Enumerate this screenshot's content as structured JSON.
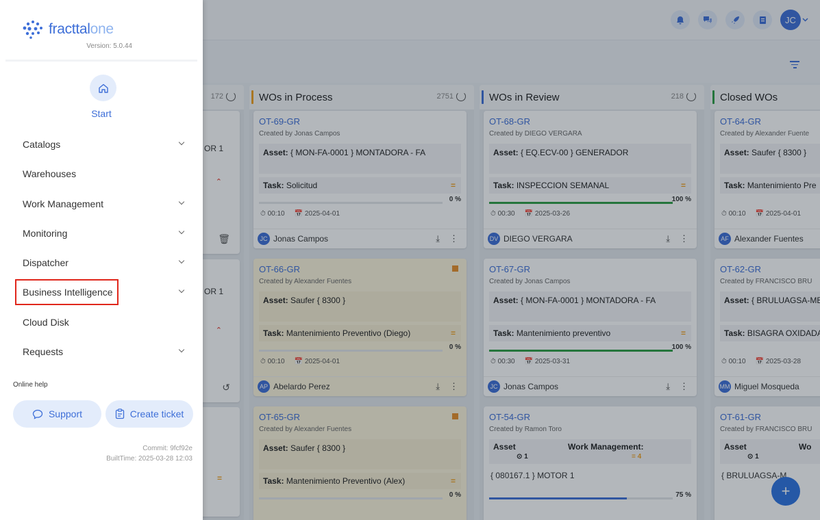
{
  "app": {
    "brand_name": "fracttal",
    "brand_suffix": "one",
    "version": "Version: 5.0.44"
  },
  "header": {
    "user_initials": "JC",
    "icons": [
      "bell-icon",
      "chat-icon",
      "rocket-icon",
      "document-icon"
    ]
  },
  "board": {
    "partial_count": "172",
    "columns": [
      {
        "title": "WOs in Process",
        "count": "2751",
        "color": "#f0a020",
        "cards": [
          {
            "wo": "OT-69-GR",
            "by": "Created by Jonas Campos",
            "asset": "{ MON-FA-0001 } MONTADORA - FA",
            "task": "Solicitud",
            "pct": "0 %",
            "progress": 0,
            "time": "00:10",
            "date": "2025-04-01",
            "user": "Jonas Campos",
            "initials": "JC"
          },
          {
            "wo": "OT-66-GR",
            "by": "Created by Alexander Fuentes",
            "asset": "Saufer { 8300 }",
            "task": "Mantenimiento Preventivo (Diego)",
            "pct": "0 %",
            "progress": 0,
            "time": "00:10",
            "date": "2025-04-01",
            "user": "Abelardo Perez",
            "initials": "AP"
          },
          {
            "wo": "OT-65-GR",
            "by": "Created by Alexander Fuentes",
            "asset": "Saufer { 8300 }",
            "task": "Mantenimiento Preventivo (Alex)",
            "pct": "0 %",
            "progress": 0
          }
        ]
      },
      {
        "title": "WOs in Review",
        "count": "218",
        "color": "#3e6fd8",
        "cards": [
          {
            "wo": "OT-68-GR",
            "by": "Created by DIEGO VERGARA",
            "asset": "{ EQ.ECV-00 } GENERADOR",
            "task": "INSPECCION SEMANAL",
            "pct": "100 %",
            "progress": 1,
            "time": "00:30",
            "date": "2025-03-26",
            "user": "DIEGO VERGARA",
            "initials": "DV"
          },
          {
            "wo": "OT-67-GR",
            "by": "Created by Jonas Campos",
            "asset": "{ MON-FA-0001 } MONTADORA - FA",
            "task": "Mantenimiento preventivo",
            "pct": "100 %",
            "progress": 1,
            "time": "00:30",
            "date": "2025-03-31",
            "user": "Jonas Campos",
            "initials": "JC"
          },
          {
            "wo": "OT-54-GR",
            "by": "Created by Ramon Toro",
            "asset_h": "Asset",
            "wm_h": "Work Management:",
            "asset_n": "1",
            "wm_n": "= 4",
            "asset_line": "{ 080167.1 } MOTOR 1",
            "pct": "75 %",
            "progress": 0.75
          }
        ]
      },
      {
        "title": "Closed WOs",
        "count": "",
        "color": "#2f9e44",
        "cards": [
          {
            "wo": "OT-64-GR",
            "by": "Created by Alexander Fuente",
            "asset": "Saufer { 8300 }",
            "task": "Mantenimiento Pre",
            "time": "00:10",
            "date": "2025-04-01",
            "user": "Alexander Fuentes",
            "initials": "AF"
          },
          {
            "wo": "OT-62-GR",
            "by": "Created by FRANCISCO BRU",
            "asset": "{ BRULUAGSA-ME",
            "task": "BISAGRA OXIDADA",
            "time": "00:10",
            "date": "2025-03-28",
            "user": "Miguel Mosqueda",
            "initials": "MM"
          },
          {
            "wo": "OT-61-GR",
            "by": "Created by FRANCISCO BRU",
            "asset_h": "Asset",
            "wm_h": "Wo",
            "asset_n": "1",
            "asset_line": "{ BRULUAGSA-M"
          }
        ]
      }
    ]
  },
  "partial_col": {
    "or1": "OR 1",
    "or2": "OR 1"
  },
  "labels": {
    "asset": "Asset:",
    "task": "Task:"
  },
  "drawer": {
    "start": "Start",
    "items": [
      {
        "label": "Catalogs",
        "chevron": true
      },
      {
        "label": "Warehouses",
        "chevron": false
      },
      {
        "label": "Work Management",
        "chevron": true
      },
      {
        "label": "Monitoring",
        "chevron": true
      },
      {
        "label": "Dispatcher",
        "chevron": true
      },
      {
        "label": "Business Intelligence",
        "chevron": true
      },
      {
        "label": "Cloud Disk",
        "chevron": false
      },
      {
        "label": "Requests",
        "chevron": true
      }
    ],
    "online_help": "Online help",
    "support": "Support",
    "create_ticket": "Create ticket",
    "commit": "Commit: 9fcf92e",
    "built": "BuiltTime: 2025-03-28 12:03"
  },
  "fab": "+"
}
